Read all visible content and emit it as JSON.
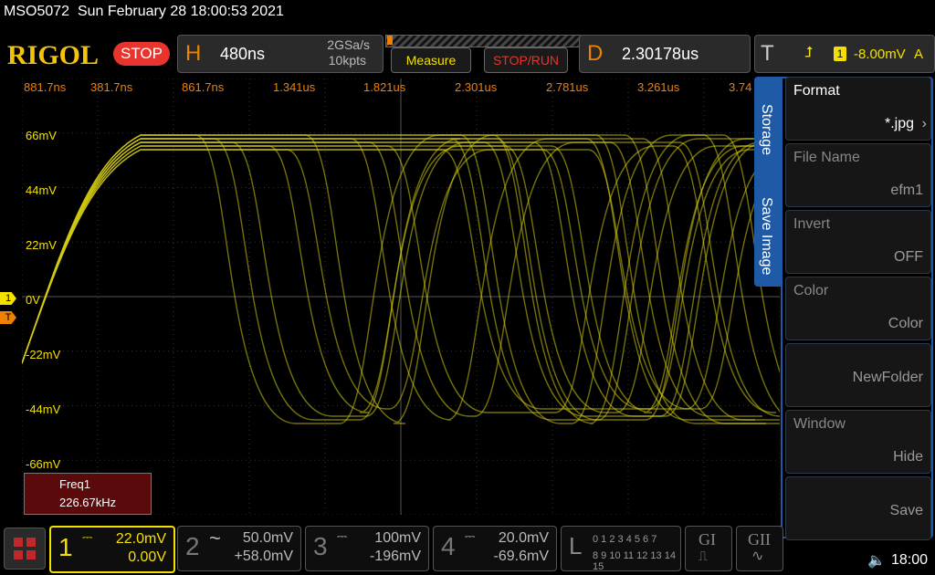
{
  "status_bar": {
    "model": "MSO5072",
    "datetime": "Sun February 28 18:00:53 2021"
  },
  "header": {
    "brand": "RIGOL",
    "run_state": "STOP",
    "horizontal": {
      "letter": "H",
      "timebase": "480ns",
      "sample_rate": "2GSa/s",
      "memory_depth": "10kpts"
    },
    "measure_label": "Measure",
    "stop_run_label": "STOP/RUN",
    "delay": {
      "letter": "D",
      "value": "2.30178us"
    },
    "trigger": {
      "letter": "T",
      "channel": "1",
      "level": "-8.00mV",
      "mode": "A"
    }
  },
  "time_labels": [
    "881.7ns",
    "381.7ns",
    "861.7ns",
    "1.341us",
    "1.821us",
    "2.301us",
    "2.781us",
    "3.261us",
    "3.74"
  ],
  "volt_labels": [
    "66mV",
    "44mV",
    "22mV",
    "0V",
    "-22mV",
    "-44mV",
    "-66mV"
  ],
  "markers": {
    "ch1": "1",
    "trigger": "T"
  },
  "measurement": {
    "name": "Freq1",
    "value": "226.67kHz"
  },
  "side_tabs": {
    "storage": "Storage",
    "save_image": "Save Image"
  },
  "menu": [
    {
      "title": "Format",
      "value": "*.jpg"
    },
    {
      "title": "File Name",
      "value": "efm1"
    },
    {
      "title": "Invert",
      "value": "OFF"
    },
    {
      "title": "Color",
      "value": "Color"
    },
    {
      "title": "",
      "value": "NewFolder"
    },
    {
      "title": "Window",
      "value": "Hide"
    },
    {
      "title": "",
      "value": "Save"
    }
  ],
  "channels": [
    {
      "num": "1",
      "coupling": "⎓",
      "scale": "22.0mV",
      "offset": "0.00V",
      "color": "#f3e000"
    },
    {
      "num": "2",
      "coupling": "~",
      "scale": "50.0mV",
      "offset": "+58.0mV",
      "color": "#777777"
    },
    {
      "num": "3",
      "coupling": "⎓",
      "scale": "100mV",
      "offset": "-196mV",
      "color": "#777777"
    },
    {
      "num": "4",
      "coupling": "⎓",
      "scale": "20.0mV",
      "offset": "-69.6mV",
      "color": "#777777"
    }
  ],
  "logic": {
    "letter": "L",
    "row1": "0 1 2 3  4 5 6 7",
    "row2": "8 9 10 11 12 13 14 15"
  },
  "gi_label": "GI",
  "gii_label": "GII",
  "clock": "18:00",
  "colors": {
    "trace": "#d4cc10",
    "accent": "#f08000",
    "brand": "#f3c20a",
    "run_red": "#e8342c",
    "tab_blue": "#1e5aa6"
  }
}
